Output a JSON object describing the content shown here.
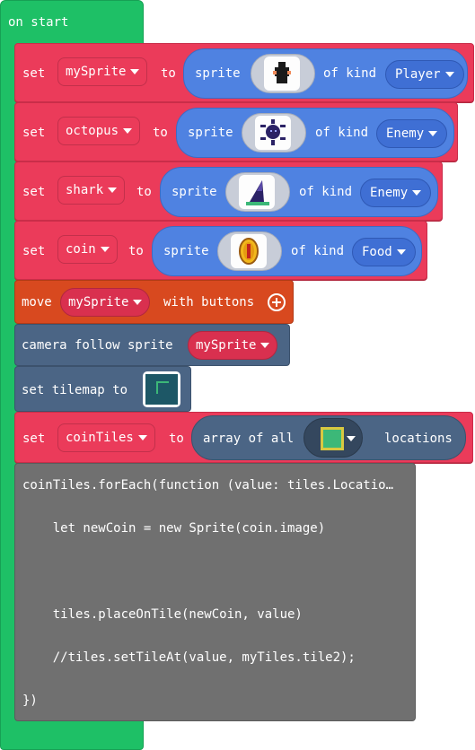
{
  "event": {
    "label": "on start"
  },
  "set_word": "set",
  "to_word": "to",
  "sprite_word": "sprite",
  "of_kind_word": "of kind",
  "sprites": [
    {
      "var": "mySprite",
      "kind": "Player",
      "icon": "ghost-sprite-icon"
    },
    {
      "var": "octopus",
      "kind": "Enemy",
      "icon": "octopus-sprite-icon"
    },
    {
      "var": "shark",
      "kind": "Enemy",
      "icon": "shark-fin-sprite-icon"
    },
    {
      "var": "coin",
      "kind": "Food",
      "icon": "coin-sprite-icon"
    }
  ],
  "move_block": {
    "move": "move",
    "var": "mySprite",
    "with_buttons": "with buttons"
  },
  "camera_block": {
    "label": "camera follow sprite",
    "var": "mySprite"
  },
  "tilemap_block": {
    "label": "set tilemap to"
  },
  "array_block": {
    "var": "coinTiles",
    "array_of_all": "array of all",
    "locations": "locations"
  },
  "code_block": {
    "lines": [
      "coinTiles.forEach(function (value: tiles.Locatio…",
      "    let newCoin = new Sprite(coin.image)",
      "    tiles.placeOnTile(newCoin, value)",
      "    //tiles.setTileAt(value, myTiles.tile2);",
      "})"
    ]
  },
  "colors": {
    "event": "#1ec066",
    "set": "#eb3b5a",
    "sprite": "#4f82e1",
    "move": "#d8491f",
    "camera": "#4b6585",
    "code": "#707070"
  }
}
